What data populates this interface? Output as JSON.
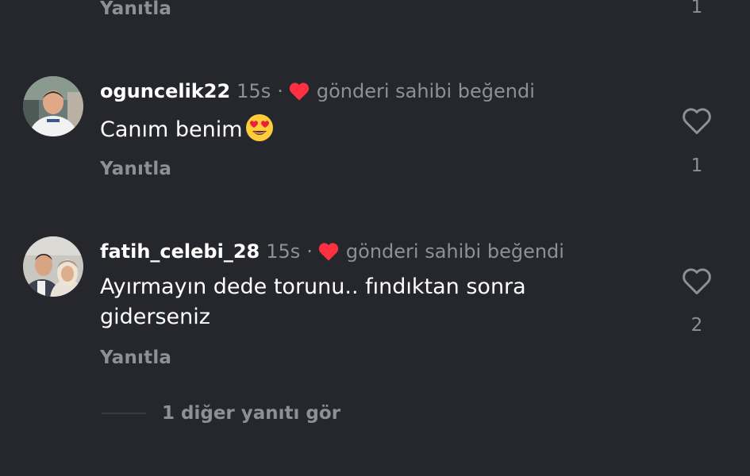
{
  "top_partial": {
    "reply_label": "Yanıtla",
    "like_count": "1"
  },
  "comments": [
    {
      "username": "oguncelik22",
      "time": "15s",
      "separator": "·",
      "liked_by_author": "gönderi sahibi beğendi",
      "text": "Canım benim",
      "emoji": "smiling-face-with-heart-eyes",
      "reply_label": "Yanıtla",
      "like_count": "1"
    },
    {
      "username": "fatih_celebi_28",
      "time": "15s",
      "separator": "·",
      "liked_by_author": "gönderi sahibi beğendi",
      "text": "Ayırmayın dede torunu.. fındıktan sonra gidersiniz",
      "text_line1": "Ayırmayın dede torunu.. fındıktan sonra",
      "text_line2": "giderseniz",
      "reply_label": "Yanıtla",
      "like_count": "2"
    }
  ],
  "more_replies_label": "1 diğer yanıtı gör",
  "colors": {
    "background": "#26272d",
    "text_primary": "#ffffff",
    "text_secondary": "#8f9096",
    "liked_heart": "#ff3040"
  },
  "icons": {
    "like": "heart-outline-icon",
    "liked_by_author": "heart-filled-icon"
  }
}
